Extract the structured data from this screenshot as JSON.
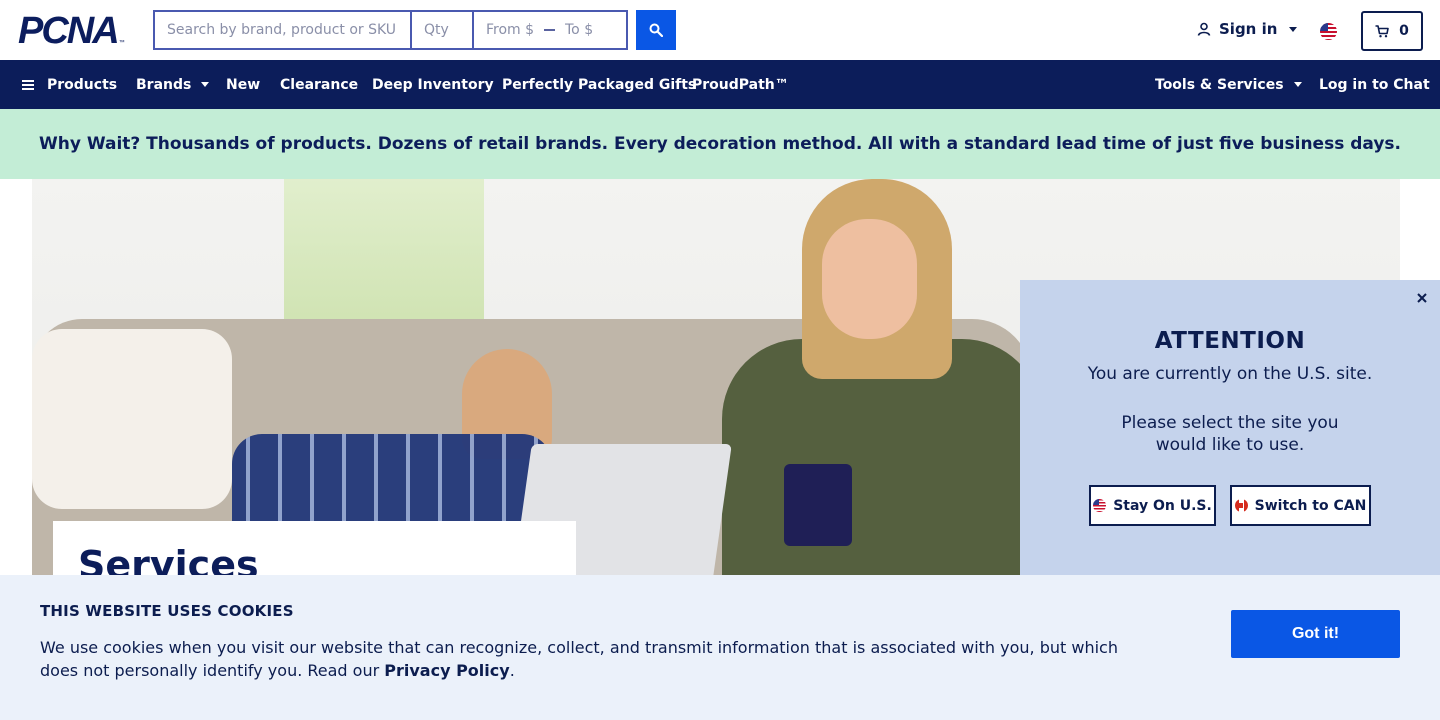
{
  "header": {
    "logo_text": "PCNA",
    "logo_tm": "™",
    "search": {
      "placeholder": "Search by brand, product or SKU",
      "qty_placeholder": "Qty",
      "from_placeholder": "From $",
      "to_placeholder": "To $"
    },
    "signin_label": "Sign in",
    "cart_count": "0"
  },
  "nav": {
    "items": [
      {
        "label": "Products"
      },
      {
        "label": "Brands"
      },
      {
        "label": "New"
      },
      {
        "label": "Clearance"
      },
      {
        "label": "Deep Inventory"
      },
      {
        "label": "Perfectly Packaged Gifts"
      },
      {
        "label": "ProudPath™"
      }
    ],
    "right": [
      {
        "label": "Tools & Services"
      },
      {
        "label": "Log in to Chat"
      }
    ]
  },
  "promo": {
    "text": "Why Wait? Thousands of products. Dozens of retail brands. Every decoration method. All with a standard lead time of just five business days."
  },
  "hero": {
    "title": "Services"
  },
  "attention": {
    "title": "ATTENTION",
    "line1": "You are currently on the U.S. site.",
    "line2": "Please select the site you would like to use.",
    "stay_label": "Stay On U.S.",
    "switch_label": "Switch to CAN"
  },
  "cookies": {
    "title": "THIS WEBSITE USES COOKIES",
    "text_before": "We use cookies when you visit our website that can recognize, collect, and transmit information that is associated with you, but which does not personally identify you. Read our ",
    "link_text": "Privacy Policy",
    "text_after": ".",
    "button_label": "Got it!"
  },
  "colors": {
    "navy": "#0c1d5a",
    "accent_blue": "#0a57e5",
    "promo_green": "#c3edd6",
    "popup_bg": "#c5d3ec",
    "cookie_bg": "#ebf1fa"
  },
  "icons": {
    "search_button": "search-icon",
    "signin": "user-icon",
    "cart": "cart-icon",
    "menu": "hamburger-icon",
    "close": "close-icon",
    "region": "us-flag-icon"
  }
}
